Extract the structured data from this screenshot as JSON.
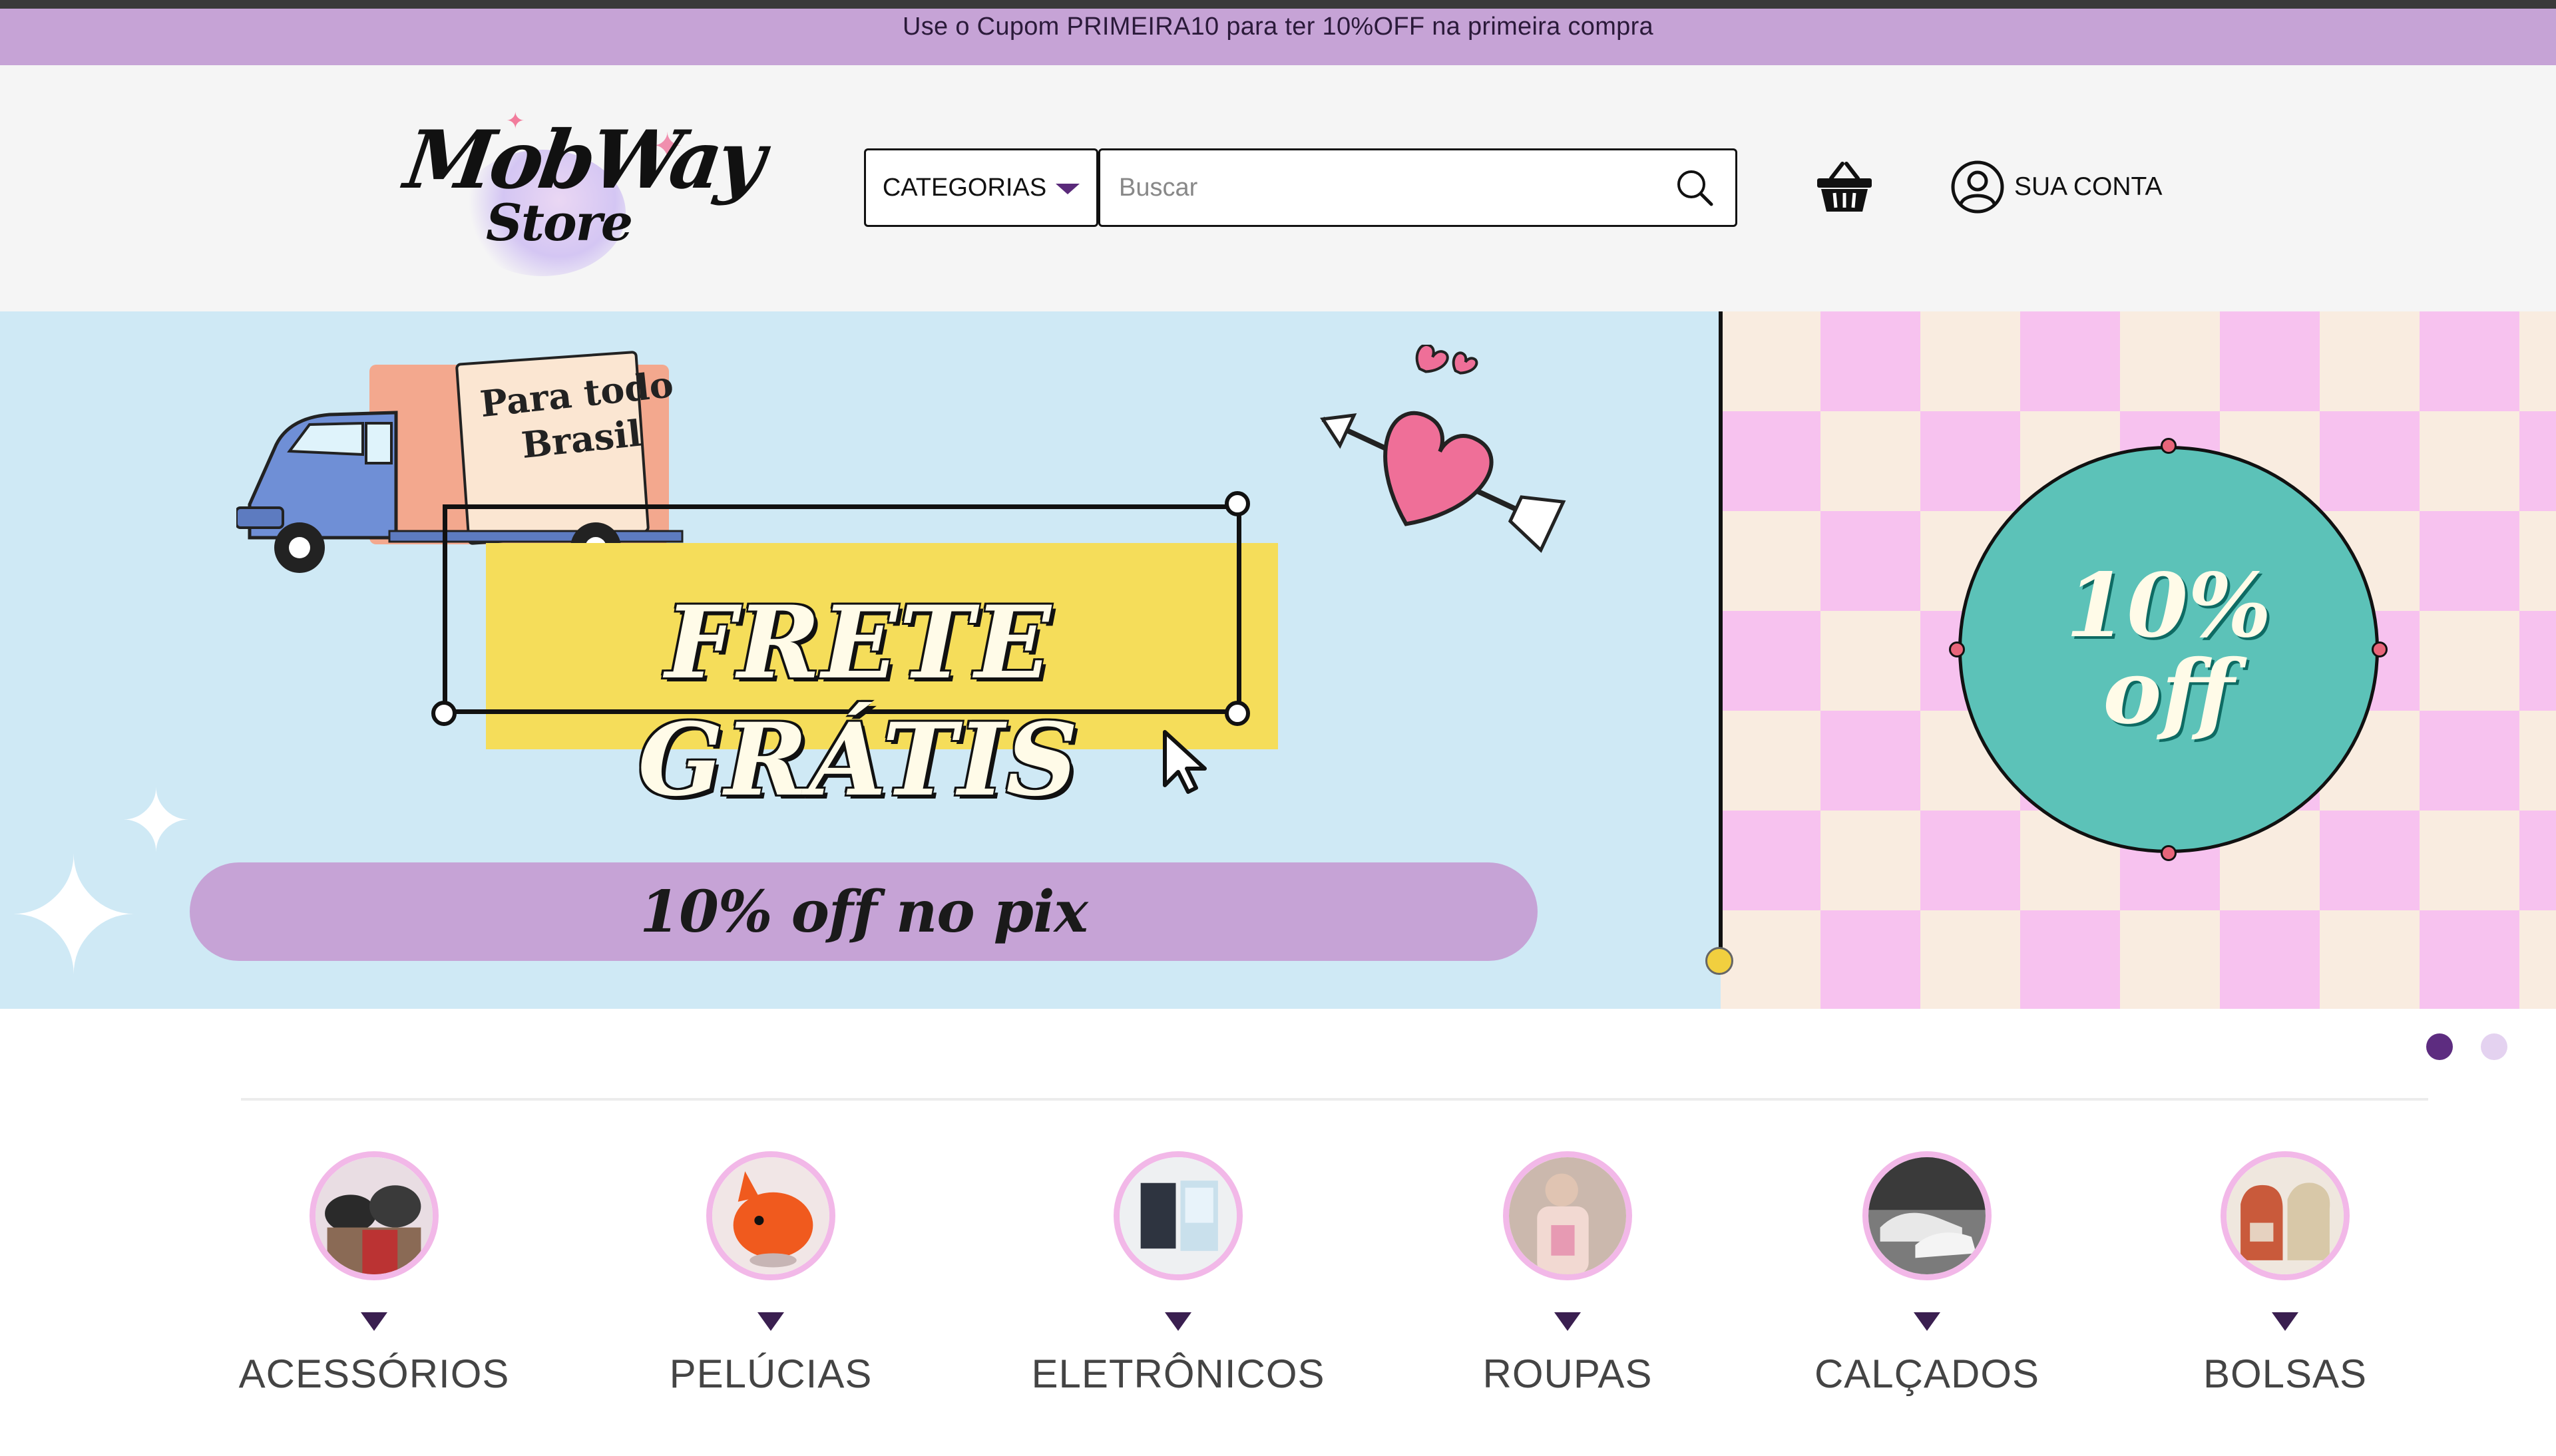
{
  "promo": {
    "text": "Use o Cupom PRIMEIRA10 para ter 10%OFF na primeira compra"
  },
  "header": {
    "logo": {
      "line1": "MobWay",
      "line2": "Store"
    },
    "categories_button": "CATEGORIAS",
    "search": {
      "placeholder": "Buscar",
      "value": ""
    },
    "cart_icon": "basket-icon",
    "account": {
      "label": "SUA CONTA",
      "icon": "user-circle-icon"
    }
  },
  "banner": {
    "slide_left": {
      "truck_text": "Para todo Brasil",
      "title": "FRETE GRÁTIS",
      "pill_text": "10% off no pix"
    },
    "slide_right": {
      "offer_line1": "10%",
      "offer_line2": "off"
    },
    "dots": {
      "count": 2,
      "active_index": 0
    }
  },
  "categories": [
    {
      "label": "ACESSÓRIOS",
      "icon": "accessories-photo"
    },
    {
      "label": "PELÚCIAS",
      "icon": "plush-photo"
    },
    {
      "label": "ELETRÔNICOS",
      "icon": "electronics-photo"
    },
    {
      "label": "ROUPAS",
      "icon": "clothes-photo"
    },
    {
      "label": "CALÇADOS",
      "icon": "shoes-photo"
    },
    {
      "label": "BOLSAS",
      "icon": "bags-photo"
    }
  ],
  "colors": {
    "promo_bg": "#c6a3d6",
    "header_bg": "#f5f5f5",
    "banner_bg": "#cfe9f5",
    "accent_purple": "#5d2c80",
    "offer_teal": "#5cc2b8",
    "frete_yellow": "#f5dd5a",
    "category_ring": "#f2b8e8"
  }
}
